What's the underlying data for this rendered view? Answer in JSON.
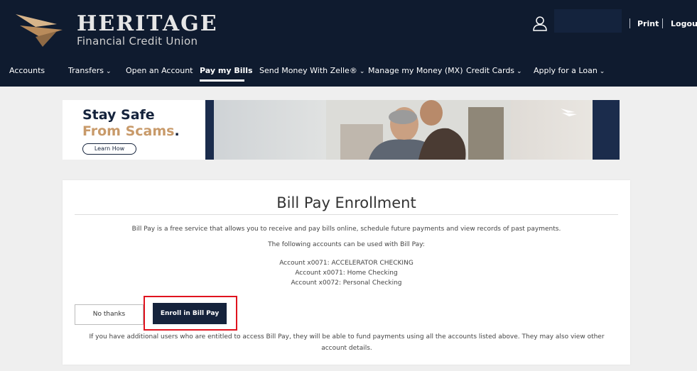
{
  "brand": {
    "name": "HERITAGE",
    "subtitle": "Financial Credit Union"
  },
  "utility": {
    "print": "Print",
    "logout": "Logout"
  },
  "nav": {
    "accounts": "Accounts",
    "transfers": "Transfers",
    "open_account": "Open an Account",
    "pay_bills": "Pay my Bills",
    "send_money": "Send Money With Zelle®",
    "manage_money": "Manage my Money (MX)",
    "credit_cards": "Credit Cards",
    "apply_loan": "Apply for a Loan",
    "chevron": "⌄",
    "active": "Pay my Bills"
  },
  "banner": {
    "line1": "Stay Safe",
    "line2": "From Scams",
    "line2_suffix": ".",
    "cta": "Learn How"
  },
  "enrollment": {
    "title": "Bill Pay Enrollment",
    "description": "Bill Pay is a free service that allows you to receive and pay bills online, schedule future payments and view records of past payments.",
    "accounts_intro": "The following accounts can be used with Bill Pay:",
    "accounts": [
      "Account x0071: ACCELERATOR CHECKING",
      "Account x0071: Home Checking",
      "Account x0072: Personal Checking"
    ],
    "no_thanks": "No thanks",
    "enroll": "Enroll in Bill Pay",
    "note": "If you have additional users who are entitled to access Bill Pay, they will be able to fund payments using all the accounts listed above. They may also view other account details."
  },
  "icons": {
    "logo": "heritage-chevron-logo",
    "user": "user-icon",
    "dropdown": "chevron-down-icon"
  },
  "colors": {
    "header_bg": "#0f1b2f",
    "brand_tan": "#c89a6a",
    "button_navy": "#15233c",
    "highlight_red": "#e0131e"
  }
}
